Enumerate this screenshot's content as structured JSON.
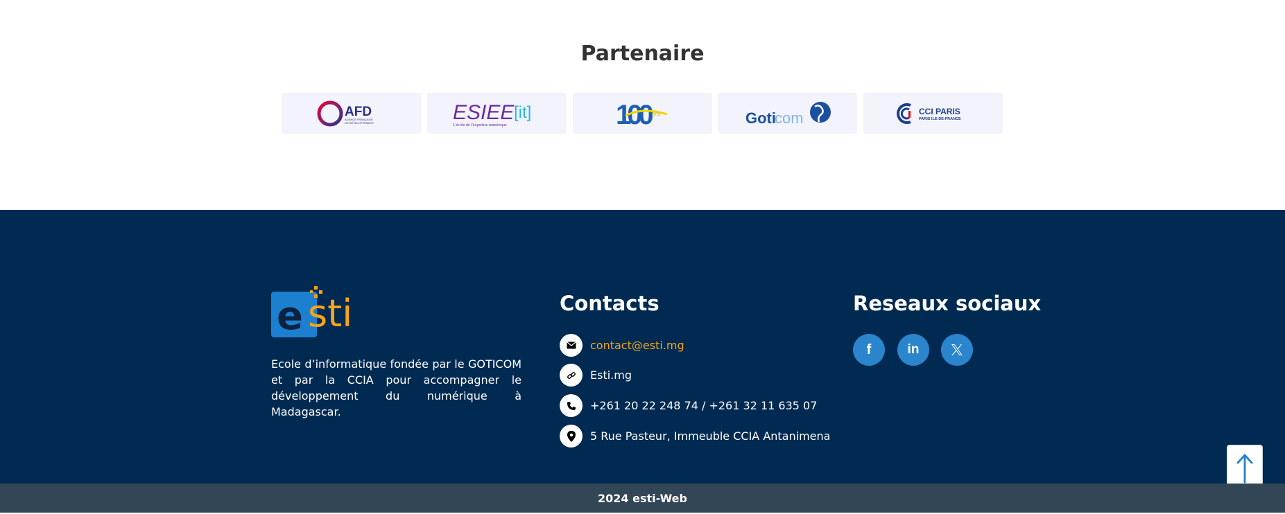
{
  "partners": {
    "title": "Partenaire",
    "logos": [
      {
        "icon": "afd-logo",
        "text": "AFD",
        "subtext": "AGENCE FRANÇAISE DE DÉVELOPPEMENT"
      },
      {
        "icon": "esiee-it-logo",
        "text": "ESIEE",
        "bracket": "[it]",
        "subtext": "L'école de l'expertise numérique"
      },
      {
        "icon": "cci-100-logo",
        "text": "100"
      },
      {
        "icon": "goticom-logo",
        "text": "Goti",
        "text2": "com"
      },
      {
        "icon": "cci-paris-logo",
        "text": "CCI PARIS",
        "subtext": "PARIS ILE-DE-FRANCE"
      }
    ]
  },
  "footer": {
    "logo": {
      "icon": "esti-logo",
      "text_e": "e",
      "text_rest": "sti"
    },
    "description": "Ecole d’informatique fondée par le GOTICOM et par la CCIA pour accompagner le développement du numérique à Madagascar.",
    "contacts_title": "Contacts",
    "contacts": [
      {
        "icon": "mail-icon",
        "text": "contact@esti.mg"
      },
      {
        "icon": "link-icon",
        "text": "Esti.mg"
      },
      {
        "icon": "phone-icon",
        "text": "+261 20 22 248 74 / +261 32 11 635 07"
      },
      {
        "icon": "location-pin-icon",
        "text": "5 Rue Pasteur, Immeuble CCIA Antanimena"
      }
    ],
    "social_title": "Reseaux sociaux",
    "social": [
      {
        "icon": "facebook-icon",
        "label": "f"
      },
      {
        "icon": "linkedin-icon",
        "label": "in"
      },
      {
        "icon": "x-twitter-icon",
        "label": "𝕏"
      }
    ]
  },
  "bottom_bar": {
    "text": "2024 esti-Web"
  },
  "scroll_top": {
    "icon": "arrow-up-icon"
  },
  "colors": {
    "footer_bg": "#002a51",
    "bottom_bar_bg": "#334655",
    "accent_orange": "#f5a41a",
    "social_blue": "#2a85cd",
    "logo_card_bg": "#f3f3fc"
  }
}
